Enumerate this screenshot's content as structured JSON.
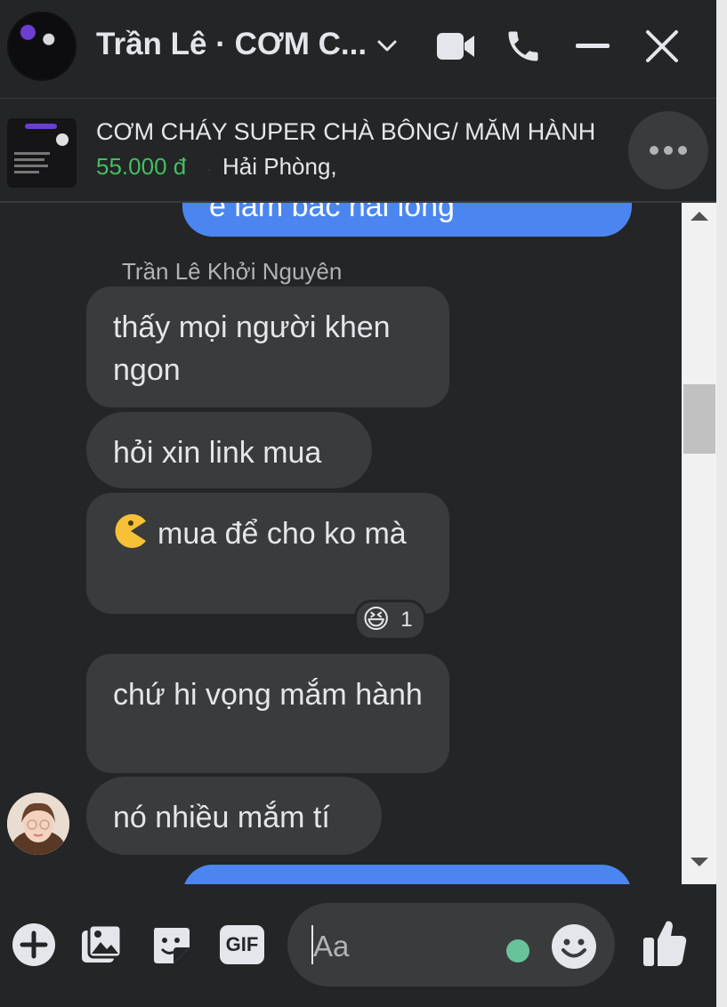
{
  "header": {
    "title": "Trần Lê · CƠM C...",
    "icons": [
      "chevron-down-icon",
      "video-call-icon",
      "phone-icon",
      "minimize-icon",
      "close-icon"
    ]
  },
  "product": {
    "title": "CƠM CHÁY SUPER CHÀ BÔNG/ MĂM HÀNH",
    "price": "55.000 đ",
    "separator": "·",
    "location": "Hải Phòng,",
    "price_color": "#45bd62"
  },
  "messages": {
    "partial_outgoing_text": "e làm bác hài lòng",
    "sender_name": "Trần Lê Khởi Nguyên",
    "items": [
      {
        "text": "thấy mọi người khen ngon"
      },
      {
        "text": "hỏi xin link mua"
      },
      {
        "text": "mua để cho ko mà",
        "emoji": "pacman-emoji-icon"
      },
      {
        "text": "chứ hi vọng mắm hành"
      },
      {
        "text": "nó nhiều mắm tí"
      }
    ],
    "reaction": {
      "emoji": "😆",
      "count": "1"
    },
    "outgoing_color": "#4b86f0",
    "incoming_color": "#3a3b3c"
  },
  "composer": {
    "placeholder": "Aa",
    "icons": [
      "plus-icon",
      "image-icon",
      "sticker-icon",
      "gif-icon",
      "emoji-icon",
      "like-icon"
    ],
    "gif_label": "GIF"
  },
  "colors": {
    "background": "#242526",
    "bubble": "#3a3b3c",
    "accent": "#4b86f0"
  }
}
